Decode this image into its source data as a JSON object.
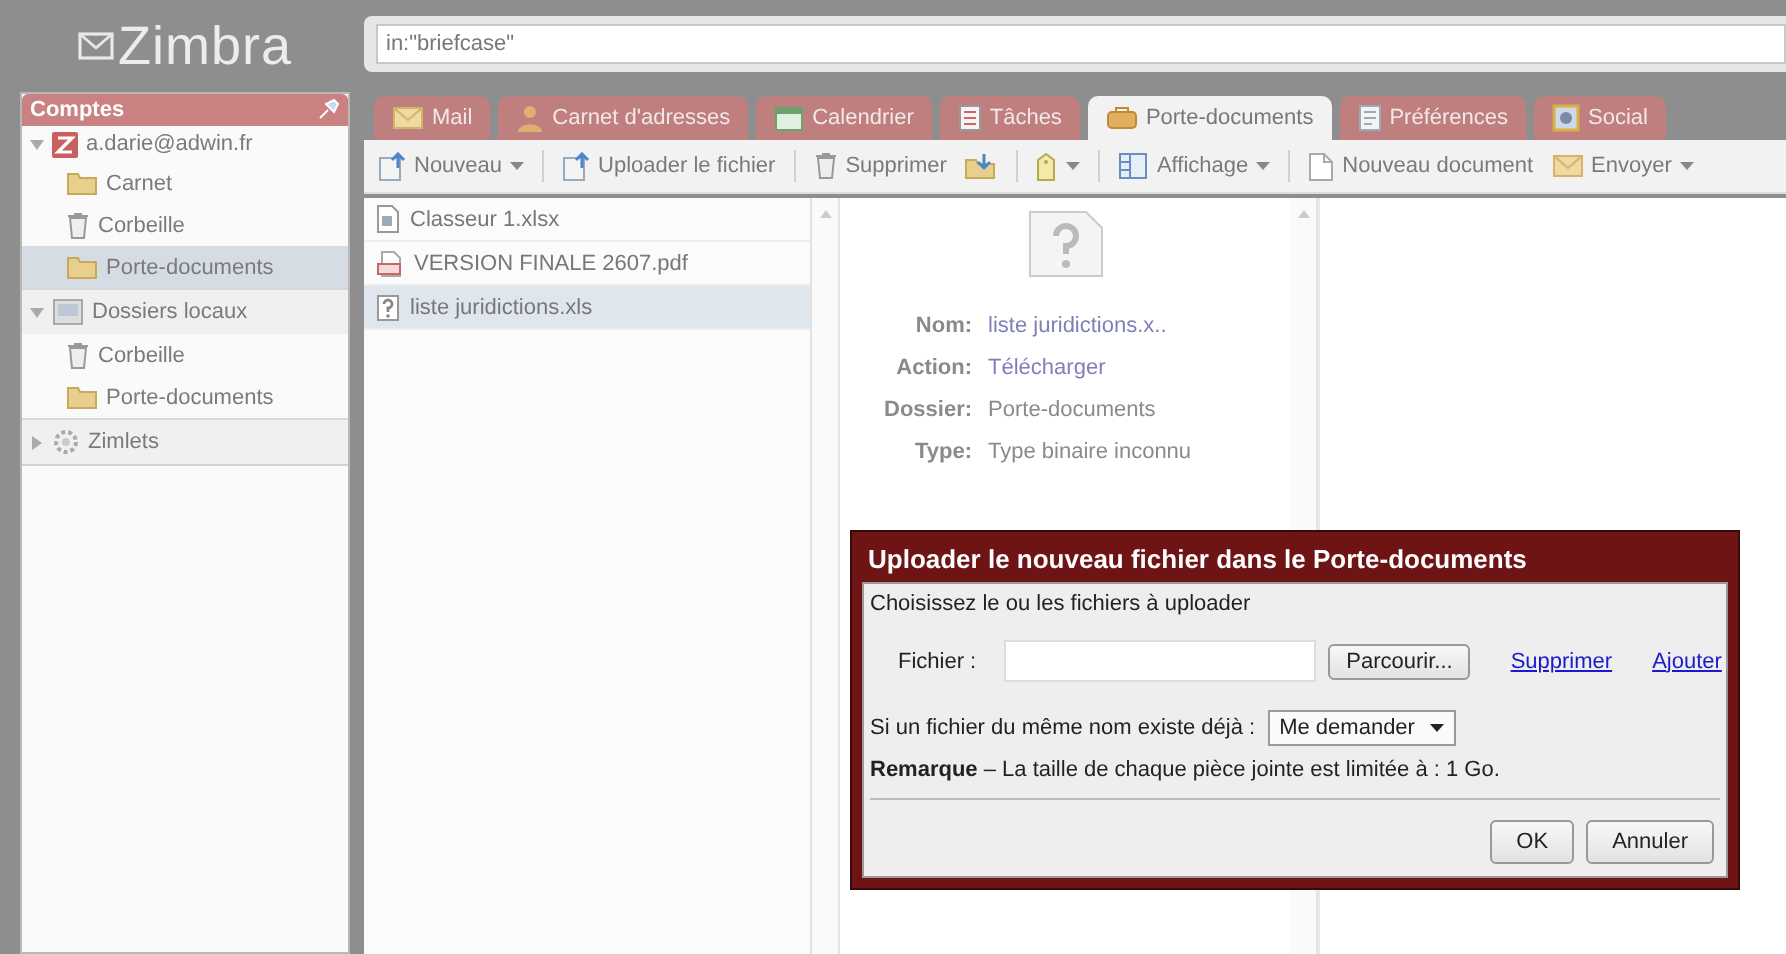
{
  "logo": {
    "text": "Zimbra"
  },
  "search": {
    "value": "in:\"briefcase\""
  },
  "sidebar": {
    "title": "Comptes",
    "items": [
      {
        "kind": "account",
        "label": "a.darie@adwin.fr",
        "expanded": true,
        "selected": false,
        "children": [
          {
            "kind": "folder",
            "label": "Carnet",
            "selected": false
          },
          {
            "kind": "trash",
            "label": "Corbeille",
            "selected": false
          },
          {
            "kind": "folder",
            "label": "Porte-documents",
            "selected": true
          }
        ]
      },
      {
        "kind": "local",
        "label": "Dossiers locaux",
        "expanded": true,
        "selected": false,
        "children": [
          {
            "kind": "trash",
            "label": "Corbeille",
            "selected": false
          },
          {
            "kind": "folder",
            "label": "Porte-documents",
            "selected": false
          }
        ]
      },
      {
        "kind": "zimlets",
        "label": "Zimlets",
        "expanded": false,
        "selected": false
      }
    ]
  },
  "tabs": [
    {
      "kind": "mail",
      "label": "Mail",
      "selected": false
    },
    {
      "kind": "contacts",
      "label": "Carnet d'adresses",
      "selected": false
    },
    {
      "kind": "calendar",
      "label": "Calendrier",
      "selected": false
    },
    {
      "kind": "tasks",
      "label": "Tâches",
      "selected": false
    },
    {
      "kind": "briefcase",
      "label": "Porte-documents",
      "selected": true
    },
    {
      "kind": "preferences",
      "label": "Préférences",
      "selected": false
    },
    {
      "kind": "social",
      "label": "Social",
      "selected": false
    }
  ],
  "toolbar": [
    {
      "kind": "upload",
      "label": "Nouveau",
      "menu": true
    },
    {
      "kind": "separator"
    },
    {
      "kind": "upload",
      "label": "Uploader le fichier",
      "menu": false
    },
    {
      "kind": "separator"
    },
    {
      "kind": "trash",
      "label": "Supprimer",
      "menu": false
    },
    {
      "kind": "move",
      "menu": false
    },
    {
      "kind": "separator"
    },
    {
      "kind": "tag",
      "menu": true
    },
    {
      "kind": "separator"
    },
    {
      "kind": "view",
      "label": "Affichage",
      "menu": true
    },
    {
      "kind": "separator"
    },
    {
      "kind": "document",
      "label": "Nouveau document",
      "menu": false
    },
    {
      "kind": "mail",
      "label": "Envoyer",
      "menu": true
    }
  ],
  "files": [
    {
      "kind": "xlsx",
      "name": "Classeur 1.xlsx",
      "selected": false
    },
    {
      "kind": "pdf",
      "name": "VERSION FINALE 2607.pdf",
      "selected": false
    },
    {
      "kind": "unknown",
      "name": "liste juridictions.xls",
      "selected": true
    }
  ],
  "preview": {
    "fields": [
      {
        "label": "Nom:",
        "value": "liste juridictions.x..",
        "kind": "link"
      },
      {
        "label": "Action:",
        "value": "Télécharger",
        "kind": "link"
      },
      {
        "label": "Dossier:",
        "value": "Porte-documents",
        "kind": "text"
      },
      {
        "label": "Type:",
        "value": "Type binaire inconnu",
        "kind": "text"
      }
    ]
  },
  "dialog": {
    "title": "Uploader le nouveau fichier dans le Porte-documents",
    "instruction": "Choisissez le ou les fichiers à uploader",
    "file_label": "Fichier :",
    "browse_button": "Parcourir...",
    "links": [
      "Supprimer",
      "Ajouter"
    ],
    "conflict_label": "Si un fichier du même nom existe déjà :",
    "conflict_select": "Me demander",
    "note": "**Remarque** – La taille de chaque pièce jointe est limitée à : 1 Go.",
    "buttons": [
      "OK",
      "Annuler"
    ]
  }
}
